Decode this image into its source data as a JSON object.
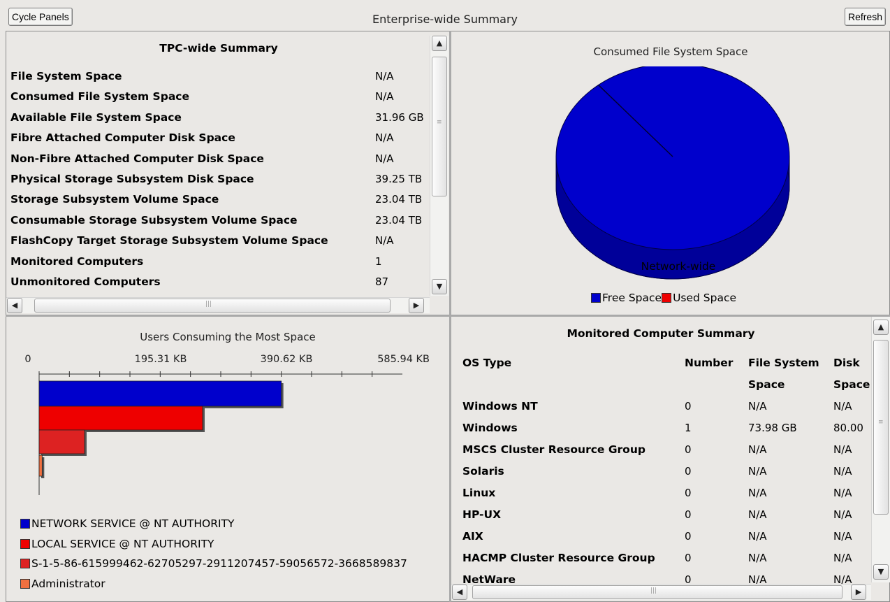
{
  "window": {
    "title": "Enterprise-wide Summary",
    "cycle_label": "Cycle Panels",
    "refresh_label": "Refresh"
  },
  "tpc_summary": {
    "title": "TPC-wide Summary",
    "rows": [
      {
        "label": "File System Space",
        "value": "N/A"
      },
      {
        "label": "Consumed File System Space",
        "value": "N/A"
      },
      {
        "label": "Available File System Space",
        "value": "31.96 GB"
      },
      {
        "label": "Fibre Attached Computer Disk Space",
        "value": "N/A"
      },
      {
        "label": "Non-Fibre Attached Computer Disk Space",
        "value": "N/A"
      },
      {
        "label": "Physical Storage Subsystem Disk Space",
        "value": "39.25 TB"
      },
      {
        "label": "Storage Subsystem Volume Space",
        "value": "23.04 TB"
      },
      {
        "label": "Consumable Storage Subsystem Volume Space",
        "value": "23.04 TB"
      },
      {
        "label": "FlashCopy Target Storage Subsystem Volume Space",
        "value": "N/A"
      },
      {
        "label": "Monitored Computers",
        "value": "1"
      },
      {
        "label": "Unmonitored Computers",
        "value": "87"
      }
    ]
  },
  "pie_panel": {
    "chart_data": {
      "type": "pie",
      "title": "Consumed File System Space",
      "categories": [
        "Free Space",
        "Used Space"
      ],
      "values": [
        100,
        0
      ],
      "colors": [
        "#0000cc",
        "#ee0000"
      ],
      "slice_label": "Network-wide",
      "legend_position": "bottom"
    }
  },
  "users_panel": {
    "chart_data": {
      "type": "bar",
      "orientation": "horizontal",
      "title": "Users Consuming the Most Space",
      "x_ticks": [
        "0",
        "195.31 KB",
        "390.62 KB",
        "585.94 KB"
      ],
      "xlim": [
        0,
        600000
      ],
      "categories": [
        "NETWORK SERVICE @ NT AUTHORITY",
        "LOCAL SERVICE @ NT AUTHORITY",
        "S-1-5-86-615999462-62705297-2911207457-59056572-3668589837",
        "Administrator"
      ],
      "values": [
        400000,
        270000,
        75000,
        5000
      ],
      "colors": [
        "#0000cc",
        "#ee0000",
        "#dd2222",
        "#f07040"
      ],
      "legend_position": "bottom-left"
    }
  },
  "monitored": {
    "title": "Monitored Computer Summary",
    "headers": {
      "os": "OS Type",
      "number": "Number",
      "fs1": "File System",
      "fs2": "Space",
      "disk1": "Disk",
      "disk2": "Space"
    },
    "rows": [
      {
        "os": "Windows NT",
        "number": "0",
        "fs": "N/A",
        "disk": "N/A"
      },
      {
        "os": "Windows",
        "number": "1",
        "fs": "73.98 GB",
        "disk": "80.00"
      },
      {
        "os": "MSCS Cluster Resource Group",
        "number": "0",
        "fs": "N/A",
        "disk": "N/A"
      },
      {
        "os": "Solaris",
        "number": "0",
        "fs": "N/A",
        "disk": "N/A"
      },
      {
        "os": "Linux",
        "number": "0",
        "fs": "N/A",
        "disk": "N/A"
      },
      {
        "os": "HP-UX",
        "number": "0",
        "fs": "N/A",
        "disk": "N/A"
      },
      {
        "os": "AIX",
        "number": "0",
        "fs": "N/A",
        "disk": "N/A"
      },
      {
        "os": "HACMP Cluster Resource Group",
        "number": "0",
        "fs": "N/A",
        "disk": "N/A"
      },
      {
        "os": "NetWare",
        "number": "0",
        "fs": "N/A",
        "disk": "N/A"
      }
    ]
  }
}
